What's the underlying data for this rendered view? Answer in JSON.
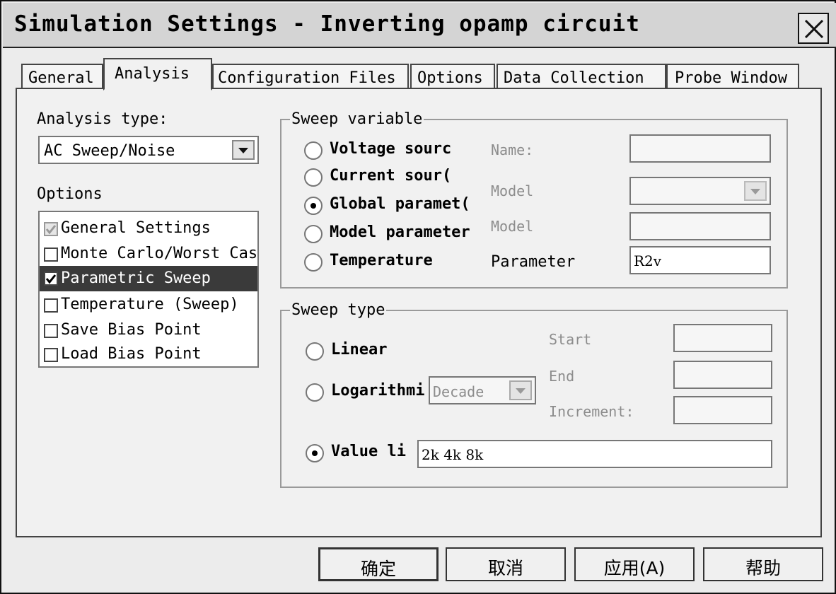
{
  "window": {
    "title": "Simulation Settings - Inverting opamp circuit"
  },
  "tabs": [
    {
      "label": "General"
    },
    {
      "label": "Analysis"
    },
    {
      "label": "Configuration Files"
    },
    {
      "label": "Options"
    },
    {
      "label": "Data Collection"
    },
    {
      "label": "Probe Window"
    }
  ],
  "analysis": {
    "type_label": "Analysis type:",
    "type_value": "AC Sweep/Noise",
    "options_label": "Options",
    "options": [
      {
        "label": "General Settings",
        "checked": true
      },
      {
        "label": "Monte Carlo/Worst Cas",
        "checked": false
      },
      {
        "label": "Parametric Sweep",
        "checked": true
      },
      {
        "label": "Temperature (Sweep)",
        "checked": false
      },
      {
        "label": "Save Bias Point",
        "checked": false
      },
      {
        "label": "Load Bias Point",
        "checked": false
      }
    ]
  },
  "sweep_variable": {
    "legend": "Sweep variable",
    "radios": [
      {
        "label": "Voltage sourc"
      },
      {
        "label": "Current sour("
      },
      {
        "label": "Global paramet("
      },
      {
        "label": "Model parameter"
      },
      {
        "label": "Temperature"
      }
    ],
    "name_label": "Name:",
    "model_type_label": "Model",
    "model_name_label": "Model",
    "parameter_label": "Parameter",
    "parameter_value": "R2v"
  },
  "sweep_type": {
    "legend": "Sweep type",
    "linear_label": "Linear",
    "log_label": "Logarithmi",
    "log_value": "Decade",
    "value_list_label": "Value li",
    "value_list_value": "2k 4k 8k",
    "start_label": "Start",
    "end_label": "End",
    "increment_label": "Increment:"
  },
  "buttons": {
    "ok": "确定",
    "cancel": "取消",
    "apply": "应用(A)",
    "help": "帮助"
  }
}
